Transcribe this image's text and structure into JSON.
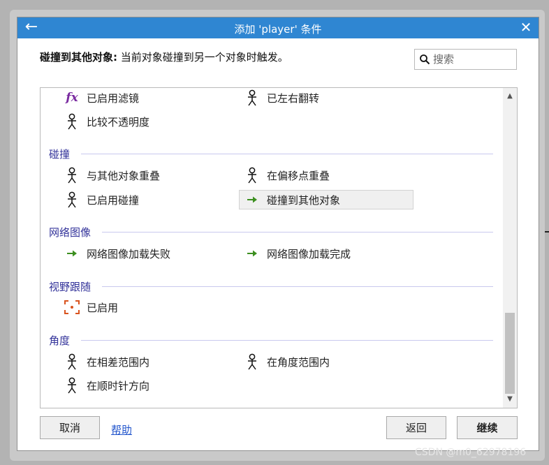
{
  "dialog": {
    "title": "添加 'player' 条件",
    "description_bold": "碰撞到其他对象:",
    "description_rest": " 当前对象碰撞到另一个对象时触发。"
  },
  "search": {
    "placeholder": "搜索"
  },
  "list": {
    "top_items": [
      {
        "label": "已启用滤镜",
        "icon": "fx-icon"
      },
      {
        "label": "已左右翻转",
        "icon": "person-icon"
      },
      {
        "label": "比较不透明度",
        "icon": "person-icon"
      }
    ],
    "categories": [
      {
        "name": "碰撞",
        "items": [
          {
            "label": "与其他对象重叠",
            "icon": "person-icon"
          },
          {
            "label": "在偏移点重叠",
            "icon": "person-icon"
          },
          {
            "label": "已启用碰撞",
            "icon": "person-icon"
          },
          {
            "label": "碰撞到其他对象",
            "icon": "arrow-icon",
            "selected": true
          }
        ]
      },
      {
        "name": "网络图像",
        "items": [
          {
            "label": "网络图像加载失败",
            "icon": "arrow-icon"
          },
          {
            "label": "网络图像加载完成",
            "icon": "arrow-icon"
          }
        ]
      },
      {
        "name": "视野跟随",
        "items": [
          {
            "label": "已启用",
            "icon": "focus-icon"
          }
        ]
      },
      {
        "name": "角度",
        "items": [
          {
            "label": "在相差范围内",
            "icon": "person-icon"
          },
          {
            "label": "在角度范围内",
            "icon": "person-icon"
          },
          {
            "label": "在顺时针方向",
            "icon": "person-icon"
          }
        ]
      }
    ]
  },
  "buttons": {
    "cancel": "取消",
    "help": "帮助",
    "back": "返回",
    "continue": "继续"
  },
  "watermark": "CSDN @m0_62978196",
  "colors": {
    "titlebar": "#2f86d2",
    "category": "#33339a",
    "arrow": "#3c8f1f",
    "focus": "#d9531e"
  }
}
